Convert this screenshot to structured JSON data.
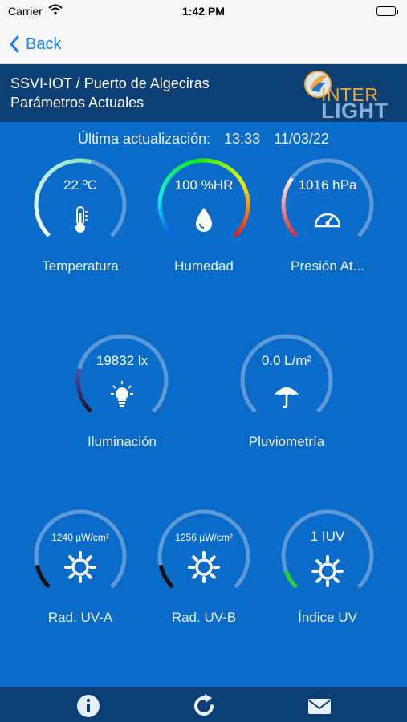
{
  "status_bar": {
    "carrier": "Carrier",
    "time": "1:42 PM",
    "wifi_icon": "wifi-icon",
    "battery_icon": "battery-icon"
  },
  "nav": {
    "back_label": "Back",
    "back_icon": "chevron-left-icon"
  },
  "header": {
    "title_line1": "SSVI-IOT / Puerto de Algeciras",
    "title_line2": "Parámetros Actuales",
    "logo_top": "INTER",
    "logo_bottom": "LIGHT"
  },
  "update": {
    "label": "Última actualización:",
    "time": "13:33",
    "date": "11/03/22"
  },
  "gauges": {
    "temperatura": {
      "value": "22 ºC",
      "label": "Temperatura",
      "icon": "thermometer-icon",
      "fill": 0.55
    },
    "humedad": {
      "value": "100 %HR",
      "label": "Humedad",
      "icon": "water-drop-icon",
      "fill": 1.0
    },
    "presion": {
      "value": "1016 hPa",
      "label": "Presión At...",
      "icon": "speedometer-icon",
      "fill": 0.3
    },
    "iluminacion": {
      "value": "19832 lx",
      "label": "Iluminación",
      "icon": "lightbulb-icon",
      "fill": 0.22
    },
    "pluviometria": {
      "value": "0.0 L/m²",
      "label": "Pluviometría",
      "icon": "umbrella-icon",
      "fill": 0.0
    },
    "uva": {
      "value": "1240 µW/cm²",
      "label": "Rad. UV-A",
      "icon": "sun-icon",
      "fill": 0.12
    },
    "uvb": {
      "value": "1256 µW/cm²",
      "label": "Rad. UV-B",
      "icon": "sun-icon",
      "fill": 0.12
    },
    "indice_uv": {
      "value": "1 IUV",
      "label": "Índice UV",
      "icon": "sun-icon",
      "fill": 0.09
    }
  },
  "colors": {
    "background": "#0a6bc9",
    "header": "#0c3f74",
    "track": "#5e9ad8",
    "accent_ios": "#1a7cf0",
    "uv_green": "#2bd42b"
  },
  "tab_bar": {
    "info_icon": "info-icon",
    "refresh_icon": "refresh-icon",
    "mail_icon": "mail-icon"
  }
}
